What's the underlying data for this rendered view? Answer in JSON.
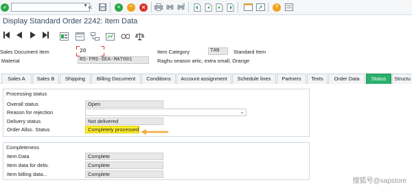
{
  "window": {
    "title": "Display Standard Order 2242: Item Data"
  },
  "toolbar": {
    "command_field_value": "",
    "icons": [
      "enter-icon",
      "save-icon",
      "back-icon",
      "exit-icon",
      "cancel-icon",
      "print-icon",
      "find-icon",
      "find-next-icon",
      "first-page-icon",
      "prev-page-icon",
      "next-page-icon",
      "last-page-icon",
      "new-session-icon",
      "shortcut-icon",
      "help-icon",
      "customize-icon"
    ]
  },
  "header": {
    "sales_doc_item_label": "Sales Document Item",
    "sales_doc_item_value": "20",
    "item_category_label": "Item Category",
    "item_category_value": "TAN",
    "item_category_text": "Standard Item",
    "material_label": "Material",
    "material_value": "RS-FMS-SEA-MAT001",
    "material_text": "Raghu season artic, extra small, Orange"
  },
  "tabs": [
    {
      "label": "Sales A"
    },
    {
      "label": "Sales B"
    },
    {
      "label": "Shipping"
    },
    {
      "label": "Billing Document"
    },
    {
      "label": "Conditions"
    },
    {
      "label": "Account assignment"
    },
    {
      "label": "Schedule lines"
    },
    {
      "label": "Partners"
    },
    {
      "label": "Texts"
    },
    {
      "label": "Order Data"
    },
    {
      "label": "Status"
    },
    {
      "label": "Structu"
    }
  ],
  "processing_status": {
    "title": "Processing status",
    "rows": [
      {
        "label": "Overall status",
        "value": "Open"
      },
      {
        "label": "Reason for rejection",
        "value": ""
      },
      {
        "label": "Delivery status",
        "value": "Not delivered"
      },
      {
        "label": "Order Alloc. Status",
        "value": "Completely processed"
      }
    ]
  },
  "completeness": {
    "title": "Completeness",
    "rows": [
      {
        "label": "Item Data",
        "value": "Complete"
      },
      {
        "label": "Item data for deliv.",
        "value": "Complete"
      },
      {
        "label": "Item billing data...",
        "value": "Complete"
      }
    ]
  },
  "watermark": {
    "text": "搜狐号@sapstore"
  },
  "colors": {
    "active_tab": "#2ab06a",
    "highlight": "#ffef2c",
    "arrow": "#f2a93b"
  }
}
